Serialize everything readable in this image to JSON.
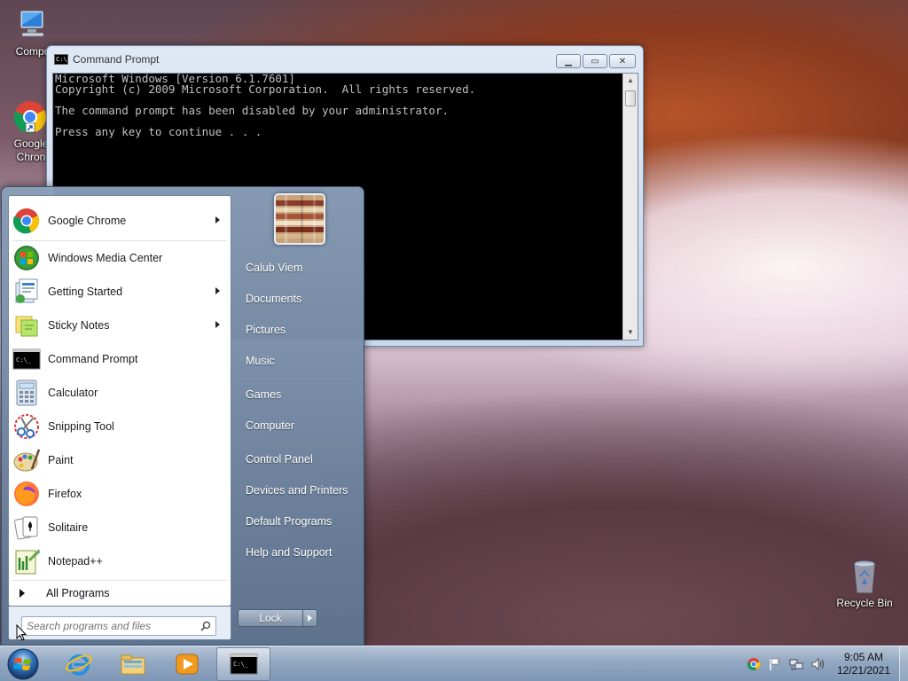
{
  "desktop": {
    "icons": [
      {
        "label": "Compu"
      },
      {
        "label": "Google Chron"
      },
      {
        "label": "Recycle Bin"
      }
    ]
  },
  "cmd_window": {
    "title": "Command Prompt",
    "lines": [
      "Microsoft Windows [Version 6.1.7601]",
      "Copyright (c) 2009 Microsoft Corporation.  All rights reserved.",
      "",
      "The command prompt has been disabled by your administrator.",
      "",
      "Press any key to continue . . ."
    ],
    "colors": {
      "background": "#000000",
      "text": "#c0c0c0"
    }
  },
  "start_menu": {
    "programs": [
      {
        "label": "Google Chrome",
        "icon": "chrome-icon",
        "has_submenu": true
      },
      {
        "label": "Windows Media Center",
        "icon": "media-center-icon",
        "has_submenu": false
      },
      {
        "label": "Getting Started",
        "icon": "getting-started-icon",
        "has_submenu": true
      },
      {
        "label": "Sticky Notes",
        "icon": "sticky-notes-icon",
        "has_submenu": true
      },
      {
        "label": "Command Prompt",
        "icon": "cmd-icon",
        "has_submenu": false
      },
      {
        "label": "Calculator",
        "icon": "calculator-icon",
        "has_submenu": false
      },
      {
        "label": "Snipping Tool",
        "icon": "snipping-tool-icon",
        "has_submenu": false
      },
      {
        "label": "Paint",
        "icon": "paint-icon",
        "has_submenu": false
      },
      {
        "label": "Firefox",
        "icon": "firefox-icon",
        "has_submenu": false
      },
      {
        "label": "Solitaire",
        "icon": "solitaire-icon",
        "has_submenu": false
      },
      {
        "label": "Notepad++",
        "icon": "notepadpp-icon",
        "has_submenu": false
      }
    ],
    "all_programs": "All Programs",
    "search_placeholder": "Search programs and files",
    "right_items": [
      "Calub Viem",
      "Documents",
      "Pictures",
      "Music",
      "Games",
      "Computer",
      "Control Panel",
      "Devices and Printers",
      "Default Programs",
      "Help and Support"
    ],
    "lock_label": "Lock"
  },
  "taskbar": {
    "pinned": [
      "ie-icon",
      "explorer-icon",
      "media-player-icon",
      "cmd-icon"
    ],
    "tray_icons": [
      "chrome-tray-icon",
      "flag-icon",
      "network-icon",
      "volume-icon"
    ],
    "time": "9:05 AM",
    "date": "12/21/2021"
  }
}
